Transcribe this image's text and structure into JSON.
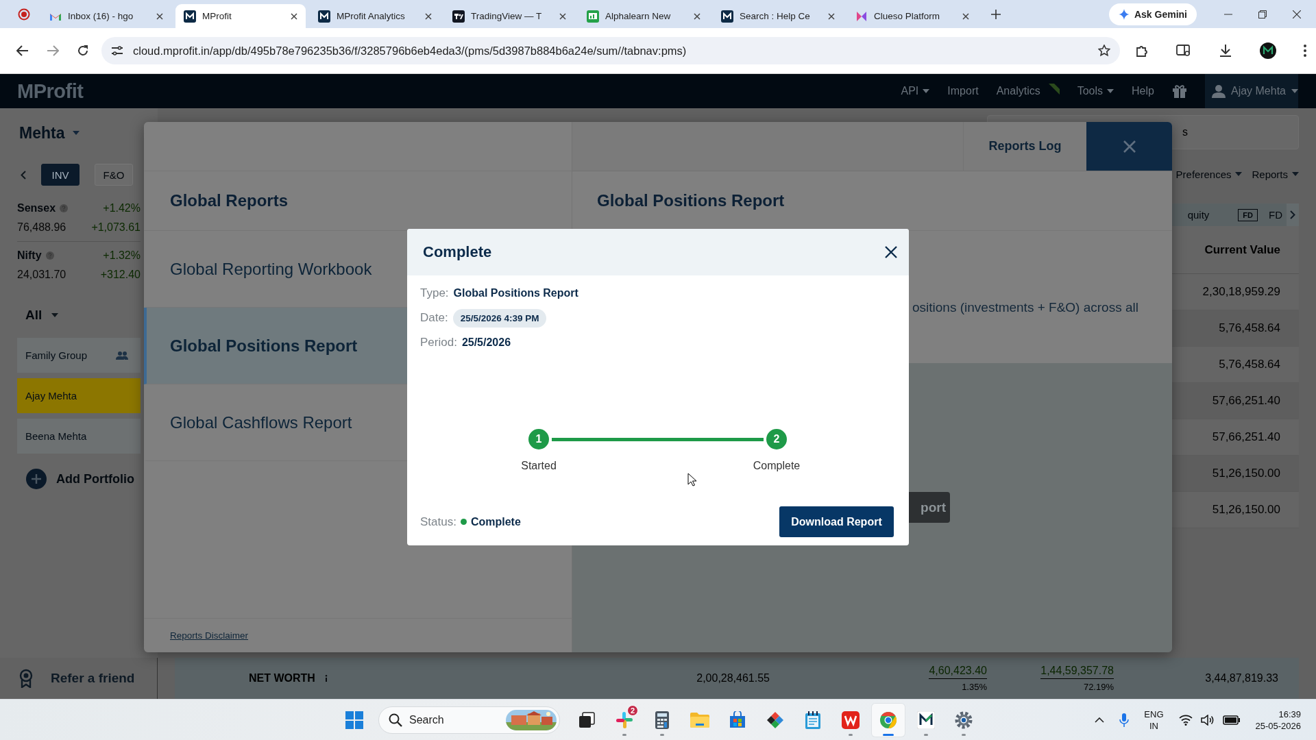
{
  "browser": {
    "tabs": [
      {
        "title": "Inbox (16) - hgo",
        "kind": "gmail",
        "selected": false
      },
      {
        "title": "MProfit",
        "kind": "mprofit",
        "selected": true
      },
      {
        "title": "MProfit Analytics",
        "kind": "mprofit",
        "selected": false
      },
      {
        "title": "TradingView — T",
        "kind": "tradingview",
        "selected": false
      },
      {
        "title": "Alphalearn New",
        "kind": "alphalearn",
        "selected": false
      },
      {
        "title": "Search : Help Ce",
        "kind": "mprofit",
        "selected": false
      },
      {
        "title": "Clueso Platform",
        "kind": "clueso",
        "selected": false
      }
    ],
    "gemini": "Ask Gemini",
    "url": "cloud.mprofit.in/app/db/495b78e796235b36/f/3285796b6eb4eda3/(pms/5d3987b884b6a24e/sum//tabnav:pms)"
  },
  "app_header": {
    "logo": "MProfit",
    "menu": [
      {
        "label": "API",
        "dropdown": true
      },
      {
        "label": "Import",
        "dropdown": false
      },
      {
        "label": "Analytics",
        "dropdown": false
      },
      {
        "label": "Tools",
        "dropdown": true
      },
      {
        "label": "Help",
        "dropdown": false
      }
    ],
    "user": "Ajay Mehta"
  },
  "sidebar": {
    "portfolio": "Mehta",
    "tabs": [
      {
        "label": "INV",
        "selected": true
      },
      {
        "label": "F&O",
        "selected": false
      }
    ],
    "indices": [
      {
        "name": "Sensex",
        "change_pct": "+1.42%",
        "value": "76,488.96",
        "change": "+1,073.61"
      },
      {
        "name": "Nifty",
        "change_pct": "+1.32%",
        "value": "24,031.70",
        "change": "+312.40"
      }
    ],
    "filter": "All",
    "portfolios": [
      {
        "name": "Family Group",
        "kind": "group",
        "selected": false
      },
      {
        "name": "Ajay Mehta",
        "kind": "person",
        "selected": true
      },
      {
        "name": "Beena Mehta",
        "kind": "person",
        "selected": false
      }
    ],
    "add_portfolio": "Add Portfolio",
    "refer": "Refer a friend"
  },
  "holdings": {
    "search": {
      "placeholder": "s"
    },
    "menus": [
      "Preferences",
      "Reports"
    ],
    "asset_tabs": [
      {
        "label": "quity",
        "kind": "text"
      },
      {
        "label": "FD",
        "kind": "badge"
      },
      {
        "label": "FD",
        "kind": "text"
      }
    ],
    "column": "Current Value",
    "rows": [
      "2,30,18,959.29",
      "5,76,458.64",
      "5,76,458.64",
      "57,66,251.40",
      "57,66,251.40",
      "51,26,150.00",
      "51,26,150.00"
    ],
    "net_worth": {
      "label": "NET WORTH",
      "values": [
        {
          "value": "2,00,28,461.55"
        },
        {
          "value": "4,60,423.40",
          "sub": "1.35%"
        },
        {
          "value": "1,44,59,357.78",
          "sub": "72.19%"
        },
        {
          "value": "3,44,87,819.33"
        }
      ]
    }
  },
  "reports_dialog": {
    "log_button": "Reports Log",
    "heading": "Global Reports",
    "items": [
      {
        "label": "Global Reporting Workbook",
        "selected": false
      },
      {
        "label": "Global Positions Report",
        "selected": true
      },
      {
        "label": "Global Cashflows Report",
        "selected": false
      }
    ],
    "disclaimer": "Reports Disclaimer",
    "detail": {
      "title": "Global Positions Report",
      "description": "ositions (investments + F&O) across all",
      "button": "port"
    }
  },
  "modal": {
    "title": "Complete",
    "fields": [
      {
        "label": "Type:",
        "value": "Global Positions Report",
        "kind": "text"
      },
      {
        "label": "Date:",
        "value": "25/5/2026 4:39 PM",
        "kind": "pill"
      },
      {
        "label": "Period:",
        "value": "25/5/2026",
        "kind": "text"
      }
    ],
    "steps": [
      {
        "number": "1",
        "label": "Started",
        "done": true
      },
      {
        "number": "2",
        "label": "Complete",
        "done": true
      }
    ],
    "status": {
      "label": "Status:",
      "value": "Complete",
      "color": "#1e9a48"
    },
    "button": "Download Report"
  },
  "taskbar": {
    "search": {
      "placeholder": "Search"
    },
    "apps": [
      {
        "kind": "start",
        "running": false,
        "active": false
      },
      {
        "kind": "taskview",
        "running": false,
        "active": false
      },
      {
        "kind": "slack",
        "badge": "2",
        "running": true,
        "active": false
      },
      {
        "kind": "calculator",
        "running": true,
        "active": false
      },
      {
        "kind": "files",
        "running": false,
        "active": false
      },
      {
        "kind": "store",
        "running": false,
        "active": false
      },
      {
        "kind": "pinwheel",
        "running": false,
        "active": false
      },
      {
        "kind": "notepad",
        "running": false,
        "active": false
      },
      {
        "kind": "wps",
        "running": true,
        "active": false
      },
      {
        "kind": "chrome",
        "running": true,
        "active": true
      },
      {
        "kind": "mprofit",
        "running": true,
        "active": false
      },
      {
        "kind": "settings",
        "running": true,
        "active": false
      }
    ],
    "language": "ENG",
    "region": "IN",
    "time": "16:39",
    "date": "25-05-2026"
  }
}
